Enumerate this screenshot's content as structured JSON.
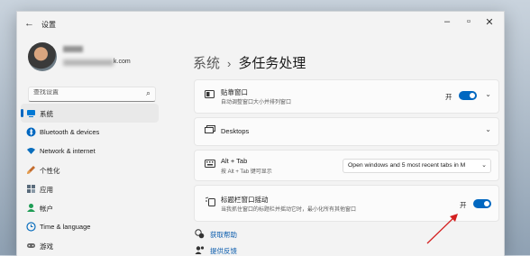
{
  "window": {
    "title": "设置",
    "back_icon": "back-arrow-icon"
  },
  "account": {
    "email_suffix": "k.com"
  },
  "search": {
    "placeholder": "查找设置"
  },
  "sidebar": {
    "items": [
      {
        "label": "系统",
        "icon": "system-icon",
        "color": "#0078d4"
      },
      {
        "label": "Bluetooth & devices",
        "icon": "bluetooth-icon",
        "color": "#0067c0"
      },
      {
        "label": "Network & internet",
        "icon": "wifi-icon",
        "color": "#0a6ebd"
      },
      {
        "label": "个性化",
        "icon": "brush-icon",
        "color": "#c46c2e"
      },
      {
        "label": "应用",
        "icon": "apps-icon",
        "color": "#5a6b7b"
      },
      {
        "label": "帐户",
        "icon": "account-icon",
        "color": "#1f9d55"
      },
      {
        "label": "Time & language",
        "icon": "globe-clock-icon",
        "color": "#0a6ebd"
      },
      {
        "label": "游戏",
        "icon": "gamepad-icon",
        "color": "#666666"
      }
    ],
    "active_index": 0
  },
  "breadcrumb": {
    "parent": "系统",
    "separator": "›",
    "current": "多任务处理"
  },
  "cards": {
    "snap": {
      "title": "贴靠窗口",
      "desc": "自动调整窗口大小并排列窗口",
      "toggle_label": "开",
      "toggle_on": true
    },
    "desktops": {
      "title": "Desktops"
    },
    "alttab": {
      "title": "Alt + Tab",
      "desc": "按 Alt + Tab 键可显示",
      "select_value": "Open windows and 5 most recent tabs in M"
    },
    "shake": {
      "title": "标题栏窗口摇动",
      "desc": "当我抓住窗口的标题栏并摇动它时，最小化所有其他窗口",
      "toggle_label": "开",
      "toggle_on": true
    }
  },
  "links": {
    "help": "获取帮助",
    "feedback": "提供反馈"
  },
  "colors": {
    "accent": "#0067c0",
    "annotation_arrow": "#d42020"
  }
}
